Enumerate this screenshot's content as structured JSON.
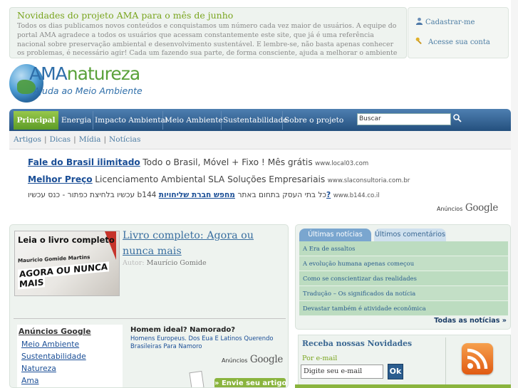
{
  "notice": {
    "title": "Novidades do projeto AMA para o mês de junho",
    "text": "Todos os dias publicamos novos conteúdos e conquistamos um número cada vez maior de usuários. A equipe do portal AMA agradece a todos os usuários que acessam constantemente este site, que já é uma referência nacional sobre preservação ambiental e desenvolvimento sustentável. E lembre-se, não basta apenas conhecer os problemas, é necessário agir! Cada um fazendo sua parte, de forma consciente, ajuda a melhorar o ambiente que todos nós vivemos."
  },
  "user": {
    "register": "Cadastrar-me",
    "login": "Acesse sua conta"
  },
  "logo": {
    "word_a": "AMA",
    "word_b": "natureza",
    "tagline": "Ajuda ao Meio Ambiente"
  },
  "nav": {
    "tabs": [
      "Principal",
      "Energia",
      "Impacto Ambiental",
      "Meio Ambiente",
      "Sustentabilidade",
      "Sobre o projeto"
    ],
    "search_value": "Buscar"
  },
  "subnav": [
    "Artigos",
    "Dicas",
    "Mídia",
    "Notícias"
  ],
  "ads": [
    {
      "title": "Fale do Brasil ilimitado",
      "text": "Todo o Brasil, Móvel + Fixo ! Mês grátis",
      "url": "www.local03.com"
    },
    {
      "title": "Melhor Preço",
      "text": "Licenciamento Ambiental SLA Soluções Empresariais",
      "url": "www.slaconsultoria.com.br"
    },
    {
      "title": "מחפש חברת שליחויות?",
      "text": "עכשיו בלחיצת כפתור - כנס עכשיו b144 כל בתי העסק בתחום באתר",
      "url": "www.b144.co.il"
    }
  ],
  "ads_by": "Anúncios",
  "google": "Google",
  "feature": {
    "image_caption": "Leia o livro completo",
    "image_author": "Mauricio Gomide Martins",
    "image_slogan_1": "AGORA OU NUNCA",
    "image_slogan_2": "MAIS",
    "title": "Livro completo: Agora ou nunca mais",
    "author_label": "Autor:",
    "author": "Maurício Gomide"
  },
  "inner_ads": {
    "title": "Anúncios Google",
    "links": [
      "Meio Ambiente",
      "Sustentabilidade",
      "Natureza",
      "Ama"
    ]
  },
  "ad_homem": {
    "title": "Homem ideal? Namorado?",
    "desc": "Homens Europeus. Dos Eua E Latinos Querendo Brasileiras Para Namoro"
  },
  "send_article": "» Envie seu artigo",
  "news": {
    "tabs": [
      "Últimas notícias",
      "Últimos comentários"
    ],
    "items": [
      "A Era de assaltos",
      "A evolução humana apenas começou",
      "Como se conscientizar das realidades",
      "Tradução – Os significados da notícia",
      "Devastar também é atividade econômica"
    ],
    "all_label": "Todas as notícias »"
  },
  "newsletter": {
    "title": "Receba nossas Novidades",
    "subtitle": "Por e-mail",
    "input_value": "Digite seu e-mail",
    "ok": "Ok"
  },
  "colors": {
    "nav_blue": "#24507e",
    "nav_active_green": "#5c9b27",
    "notice_title_green": "#7aa51f",
    "link_blue": "#1a4e96"
  }
}
